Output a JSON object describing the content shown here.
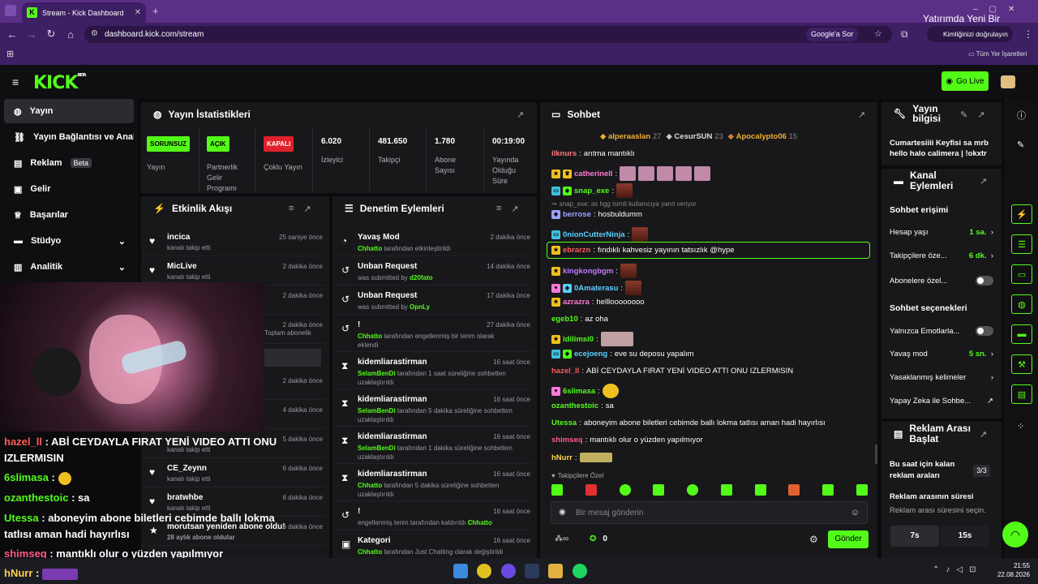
{
  "browser": {
    "tab_title": "Stream - Kick Dashboard",
    "url": "dashboard.kick.com/stream",
    "google_ask": "Google'a Sor",
    "identity": "Kimliğinizi doğrulayın",
    "bookmarks_label": "Tüm Yer İşaretleri",
    "overlay_text": "Yatırımda Yeni Bir"
  },
  "header": {
    "logo": "KICK",
    "logo_sup": "BETA",
    "go_live": "Go Live"
  },
  "sidebar": {
    "items": [
      {
        "label": "Yayın",
        "icon": "broadcast-icon"
      },
      {
        "label": "Yayın Bağlantısı ve Anahtarı",
        "icon": "link-icon"
      },
      {
        "label": "Reklam",
        "icon": "ad-icon",
        "badge": "Beta"
      },
      {
        "label": "Gelir",
        "icon": "revenue-icon"
      },
      {
        "label": "Başarılar",
        "icon": "trophy-icon"
      },
      {
        "label": "Stüdyo",
        "icon": "studio-icon"
      },
      {
        "label": "Analitik",
        "icon": "analytics-icon"
      }
    ]
  },
  "stats": {
    "title": "Yayın İstatistikleri",
    "cells": [
      {
        "badge": "SORUNSUZ",
        "label": "Yayın"
      },
      {
        "badge": "AÇIK",
        "label": "Partnerlik Gelir Programı"
      },
      {
        "badge": "KAPALI",
        "label": "Çoklu Yayın"
      },
      {
        "value": "6.020",
        "label": "İzleyici"
      },
      {
        "value": "481.650",
        "label": "Takipçi"
      },
      {
        "value": "1.780",
        "label": "Abone Sayısı"
      },
      {
        "value": "00:19:00",
        "label": "Yayında Olduğu Süre"
      }
    ]
  },
  "activity": {
    "title": "Etkinlik Akışı",
    "rows": [
      {
        "name": "incica",
        "sub": "kanalı takip etti",
        "time": "25 saniye önce"
      },
      {
        "name": "MicLive",
        "sub": "kanalı takip etti",
        "time": "2 dakika önce"
      },
      {
        "name": "",
        "sub": "",
        "time": "2 dakika önce"
      },
      {
        "name": "",
        "sub": "Toplam abonelik",
        "time": "2 dakika önce"
      },
      {
        "name": "",
        "sub": "",
        "time": ""
      },
      {
        "name": "",
        "sub": "",
        "time": "2 dakika önce"
      },
      {
        "name": "",
        "sub": "",
        "time": "4 dakika önce"
      },
      {
        "name": "",
        "sub": "kanalı takip etti",
        "time": "5 dakika önce"
      },
      {
        "name": "CE_Zeynn",
        "sub": "kanalı takip etti",
        "time": "6 dakika önce"
      },
      {
        "name": "bratwhbe",
        "sub": "kanalı takip etti",
        "time": "6 dakika önce"
      },
      {
        "name": "morutsan yeniden abone oldu!",
        "sub": "28 aylık abone oldular",
        "time": "6 dakika önce"
      }
    ]
  },
  "moderation": {
    "title": "Denetim Eylemleri",
    "rows": [
      {
        "name": "Yavaş Mod",
        "actor": "Chhatto",
        "sub": "tarafından etkinleştirildi",
        "time": "2 dakika önce",
        "icon": "slow-icon"
      },
      {
        "name": "Unban Request",
        "actor": "d20fato",
        "sub": "was submitted by",
        "time": "14 dakika önce",
        "icon": "history-icon"
      },
      {
        "name": "Unban Request",
        "actor": "OpnLy",
        "sub": "was submitted by",
        "time": "17 dakika önce",
        "icon": "history-icon"
      },
      {
        "name": "!",
        "actor": "Chhatto",
        "sub": "tarafından engellenmiş bir terim olarak eklendi",
        "time": "27 dakika önce",
        "icon": "history-icon"
      },
      {
        "name": "kidemliarastirman",
        "actor": "SelamBenDi",
        "sub": "tarafından 1 saat süreliğine sohbetten uzaklaştırıldı",
        "time": "16 saat önce",
        "icon": "hourglass-icon"
      },
      {
        "name": "kidemliarastirman",
        "actor": "SelamBenDi",
        "sub": "tarafından 5 dakika süreliğine sohbetten uzaklaştırıldı",
        "time": "16 saat önce",
        "icon": "hourglass-icon"
      },
      {
        "name": "kidemliarastirman",
        "actor": "SelamBenDi",
        "sub": "tarafından 1 dakika süreliğine sohbetten uzaklaştırıldı",
        "time": "16 saat önce",
        "icon": "hourglass-icon"
      },
      {
        "name": "kidemliarastirman",
        "actor": "Chhatto",
        "sub": "tarafından 5 dakika süreliğine sohbetten uzaklaştırıldı",
        "time": "16 saat önce",
        "icon": "hourglass-icon"
      },
      {
        "name": "!",
        "actor": "Chhatto",
        "sub": "engellenmiş terim tarafından kaldırıldı",
        "time": "16 saat önce",
        "icon": "history-icon"
      },
      {
        "name": "Kategori",
        "actor": "Chhatto",
        "sub": "tarafından Just Chatting olarak değiştirildi",
        "time": "16 saat önce",
        "icon": "category-icon"
      }
    ]
  },
  "chat": {
    "title": "Sohbet",
    "top_gifters": [
      {
        "name": "alperaaslan",
        "count": "27"
      },
      {
        "name": "CesurSUN",
        "count": "23"
      },
      {
        "name": "Apocalypto06",
        "count": "15"
      }
    ],
    "messages": [
      {
        "user": "ilknurs",
        "color": "#ff7a7a",
        "text": "arıtma mantıklı"
      },
      {
        "user": "catherinell",
        "color": "#ff7ad9",
        "text": ""
      },
      {
        "user": "snap_exe",
        "color": "#53fc18",
        "text": ""
      },
      {
        "user": "berrose",
        "color": "#a0a0ff",
        "text": "hosbuldumm"
      },
      {
        "user": "0nionCutterNinja",
        "color": "#5ad0ff",
        "text": ""
      },
      {
        "user": "ebrarzn",
        "color": "#ff5a5a",
        "text": "fındıklı kahvesiz yayının tatsızlık @hype"
      },
      {
        "user": "kingkongbgm",
        "color": "#c07aff",
        "text": ""
      },
      {
        "user": "0Amaterasu",
        "color": "#5ad0ff",
        "text": ""
      },
      {
        "user": "azrazra",
        "color": "#ff7ad9",
        "text": "hellloooooooo"
      },
      {
        "user": "egeb10",
        "color": "#53fc18",
        "text": "az oha"
      },
      {
        "user": "idilimsi0",
        "color": "#53fc18",
        "text": ""
      },
      {
        "user": "ecejoeng",
        "color": "#5ad0ff",
        "text": "eve su deposu yapalım"
      },
      {
        "user": "hazel_ll",
        "color": "#ff5a5a",
        "text": "ABİ CEYDAYLA FIRAT YENİ VIDEO ATTI ONU IZLERMISIN"
      },
      {
        "user": "6slimasa",
        "color": "#53fc18",
        "text": ""
      },
      {
        "user": "ozanthestoic",
        "color": "#53fc18",
        "text": "sa"
      },
      {
        "user": "Utessa",
        "color": "#53fc18",
        "text": "aboneyim abone biletleri cebimde ballı lokma tatlısı aman hadi hayırlısı"
      },
      {
        "user": "shimseq",
        "color": "#ff5a8a",
        "text": "mantıklı olur o yüzden yapılmıyor"
      },
      {
        "user": "hNurr",
        "color": "#ffd24a",
        "text": ""
      }
    ],
    "reply_note": "snap_exe: as hgg isimli kullanıcıya yanıt veriyor",
    "followers_only": "Takipçilere Özel",
    "input_placeholder": "Bir mesaj gönderin",
    "points": "0",
    "send": "Gönder"
  },
  "stream_info": {
    "title": "Yayın bilgisi",
    "text": "Cumartesiiii Keyfisi sa mrb hello halo calimera | !okxtr"
  },
  "chat_actions": {
    "title": "Kanal Eylemleri",
    "access_title": "Sohbet erişimi",
    "account_age": "Hesap yaşı",
    "account_age_val": "1 sa.",
    "followers_only": "Takipçilere öze...",
    "followers_only_val": "6 dk.",
    "subs_only": "Abonelere özel...",
    "options_title": "Sohbet seçenekleri",
    "emotes_only": "Yalnızca Emotlarla...",
    "slow_mode": "Yavaş mod",
    "slow_mode_val": "5 sn.",
    "banned_words": "Yasaklanmış kelimeler",
    "ai_chat": "Yapay Zeka ile Sohbe..."
  },
  "ad_break": {
    "title": "Reklam Arası Başlat",
    "hour_label": "Bu saat için kalan reklam araları",
    "hour_val": "3/3",
    "duration_label": "Reklam arasının süresi",
    "duration_hint": "Reklam arası süresini seçin.",
    "opt1": "7s",
    "opt2": "15s"
  },
  "overlay_chat": [
    {
      "user": "hazel_ll",
      "color": "#ff5a5a",
      "text": " : ABİ CEYDAYLA FIRAT YENİ VIDEO ATTI ONU"
    },
    {
      "user": "",
      "color": "#ffffff",
      "text": "IZLERMISIN"
    },
    {
      "user": "6slimasa",
      "color": "#53fc18",
      "text": " : "
    },
    {
      "user": "ozanthestoic",
      "color": "#53fc18",
      "text": " : sa"
    },
    {
      "user": "Utessa",
      "color": "#53fc18",
      "text": " : aboneyim abone biletleri cebimde ballı lokma"
    },
    {
      "user": "",
      "color": "#ffffff",
      "text": "tatlısı aman hadi hayırlısı"
    },
    {
      "user": "shimseq",
      "color": "#ff5a8a",
      "text": " : mantıklı olur o yüzden yapılmıyor"
    },
    {
      "user": "hNurr",
      "color": "#ffd24a",
      "text": " : "
    }
  ],
  "taskbar": {
    "time": "21:55",
    "date": "22.08.2026"
  },
  "colors": {
    "accent": "#53fc18",
    "panel": "#18181b",
    "bg": "#0b0b0d",
    "browser": "#3d1f64"
  }
}
